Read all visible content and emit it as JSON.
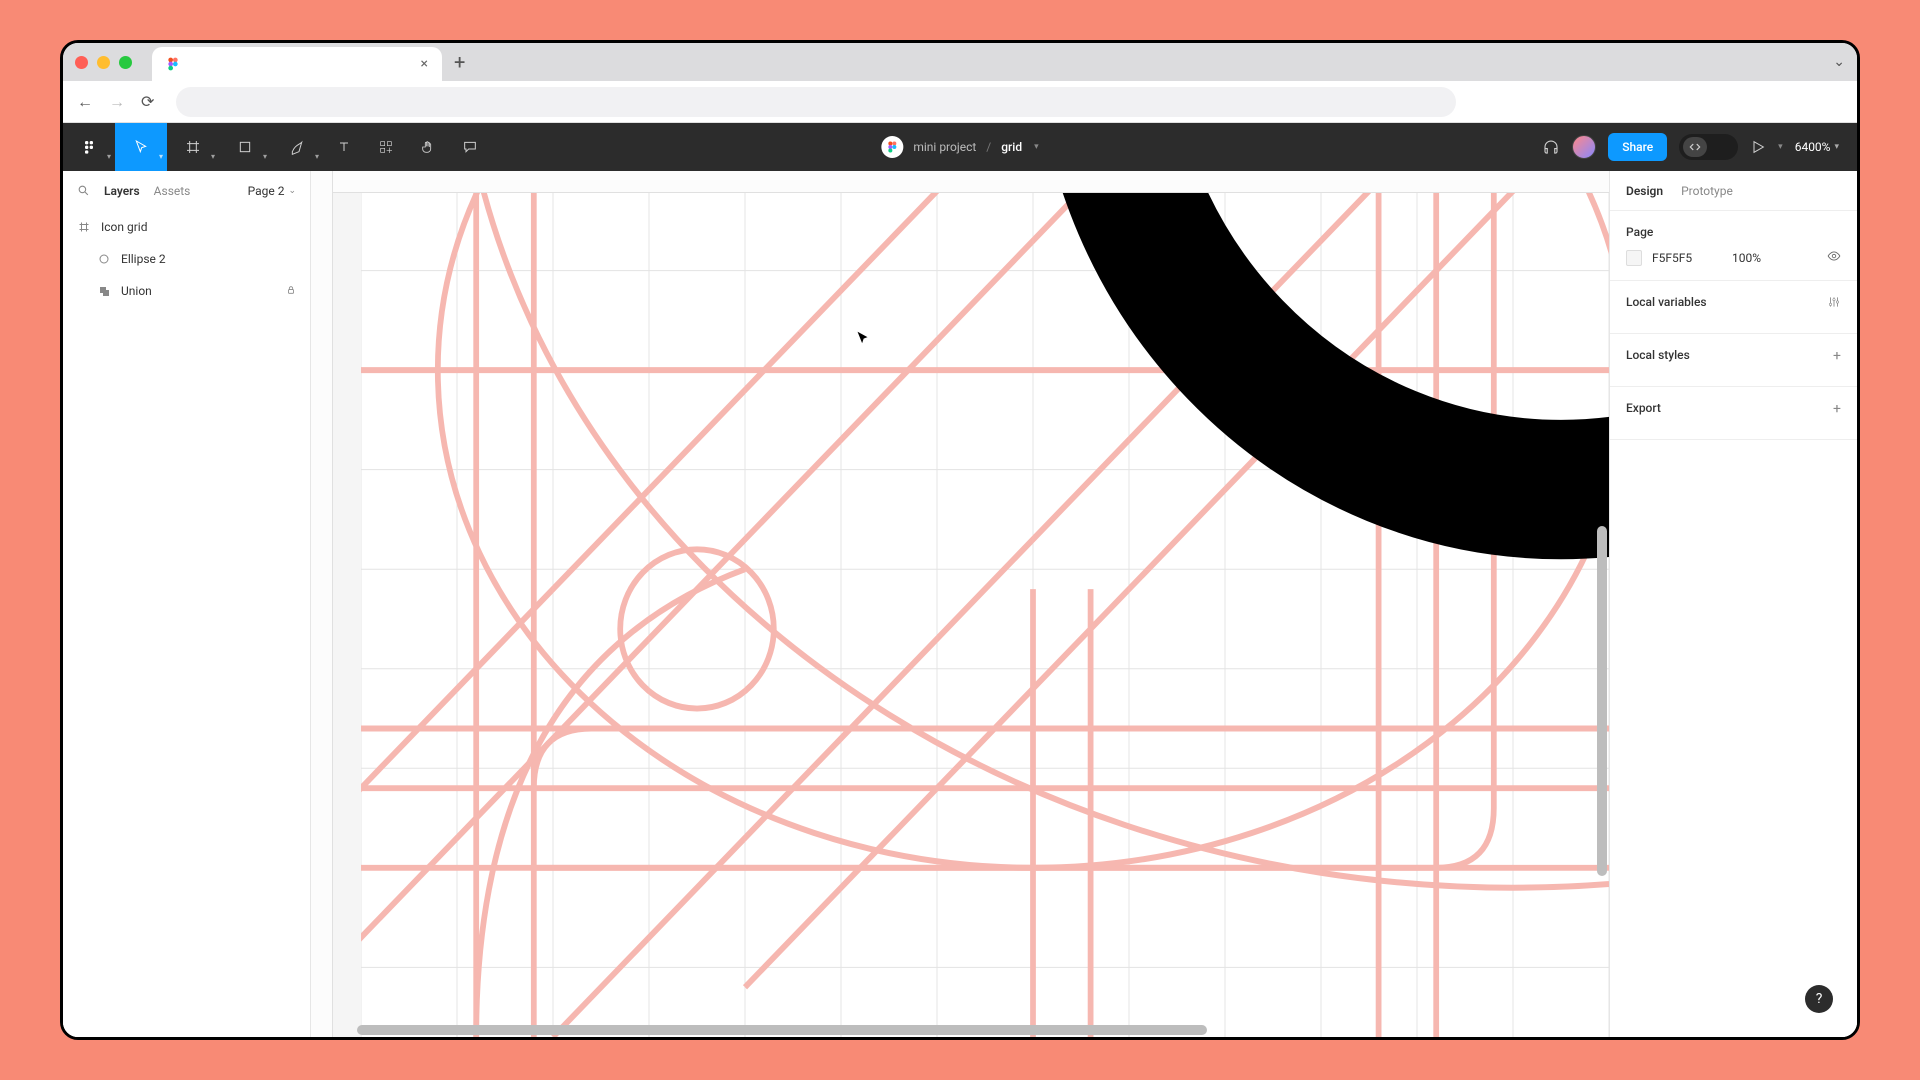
{
  "browser": {
    "tab_title": "",
    "close_glyph": "×",
    "newtab_glyph": "+"
  },
  "toolbar": {
    "project": "mini project",
    "separator": "/",
    "file": "grid",
    "share_label": "Share",
    "zoom": "6400%"
  },
  "left_panel": {
    "tab_layers": "Layers",
    "tab_assets": "Assets",
    "page_selector": "Page 2",
    "layers": [
      {
        "name": "Icon grid",
        "icon": "frame",
        "indent": 0,
        "locked": false
      },
      {
        "name": "Ellipse 2",
        "icon": "ellipse",
        "indent": 1,
        "locked": false
      },
      {
        "name": "Union",
        "icon": "union",
        "indent": 1,
        "locked": true
      }
    ]
  },
  "right_panel": {
    "tab_design": "Design",
    "tab_prototype": "Prototype",
    "page_label": "Page",
    "page_color": "F5F5F5",
    "page_opacity": "100%",
    "local_variables": "Local variables",
    "local_styles": "Local styles",
    "export": "Export"
  },
  "help_glyph": "?"
}
